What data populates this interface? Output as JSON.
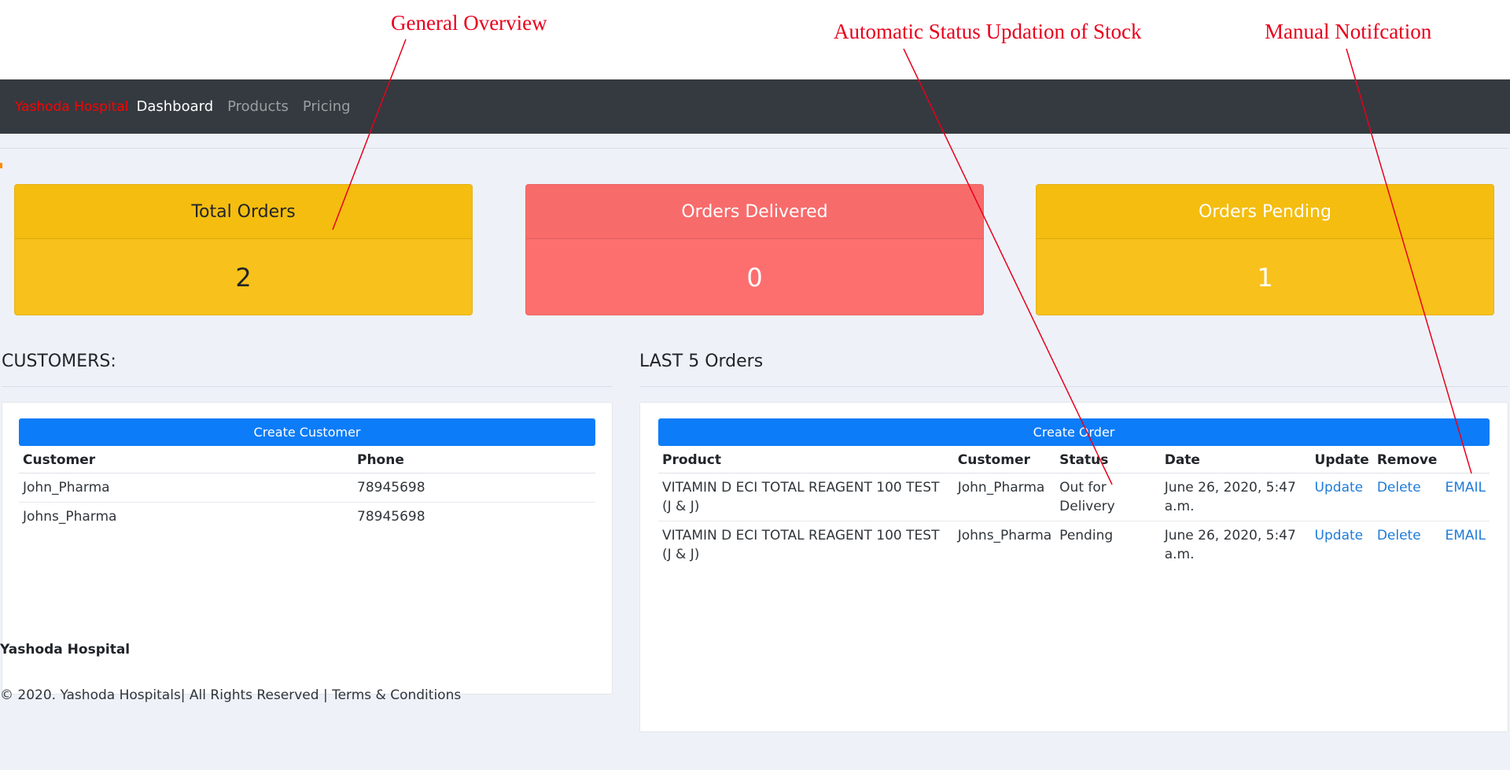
{
  "annotations": {
    "general_overview": "General Overview",
    "automatic_status": "Automatic Status Updation of Stock",
    "manual_notification": "Manual Notifcation",
    "color": "#e8001c"
  },
  "navbar": {
    "brand": "Yashoda Hospital",
    "links": [
      "Dashboard",
      "Products",
      "Pricing"
    ],
    "active": "Dashboard"
  },
  "stats": [
    {
      "label": "Total Orders",
      "value": "2"
    },
    {
      "label": "Orders Delivered",
      "value": "0"
    },
    {
      "label": "Orders Pending",
      "value": "1"
    }
  ],
  "customers": {
    "title": "CUSTOMERS:",
    "create_button": "Create Customer",
    "columns": [
      "Customer",
      "Phone"
    ],
    "rows": [
      [
        "John_Pharma",
        "78945698"
      ],
      [
        "Johns_Pharma",
        "78945698"
      ]
    ]
  },
  "orders": {
    "title": "LAST 5 Orders",
    "create_button": "Create Order",
    "columns": [
      "Product",
      "Customer",
      "Status",
      "Date",
      "Update",
      "Remove"
    ],
    "rows": [
      {
        "product": "VITAMIN D ECI TOTAL REAGENT 100 TEST (J & J)",
        "customer": "John_Pharma",
        "status": "Out for Delivery",
        "date": "June 26, 2020, 5:47 a.m.",
        "update": "Update",
        "remove": "Delete",
        "email": "EMAIL"
      },
      {
        "product": "VITAMIN D ECI TOTAL REAGENT 100 TEST (J & J)",
        "customer": "Johns_Pharma",
        "status": "Pending",
        "date": "June 26, 2020, 5:47 a.m.",
        "update": "Update",
        "remove": "Delete",
        "email": "EMAIL"
      }
    ]
  },
  "footer": {
    "title": "Yashoda Hospital",
    "copyright": "© 2020. Yashoda Hospitals| All Rights Reserved | Terms & Conditions"
  },
  "colors": {
    "navbar": "#343a40",
    "brand": "#ff0000",
    "yellow": "#f8c11b",
    "red": "#fd6f6f",
    "primary": "#0d7cf8",
    "link": "#1d7bd8",
    "page_bg": "#eef2f8"
  }
}
